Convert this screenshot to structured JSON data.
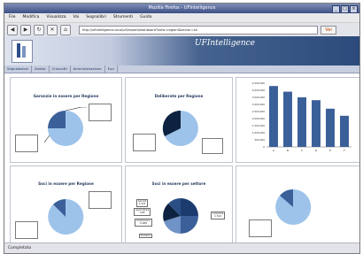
{
  "window": {
    "title": "Mozilla Firefox - UFIntelligence"
  },
  "menubar": {
    "items": [
      "File",
      "Modifica",
      "Visualizza",
      "Vai",
      "Segnalibri",
      "Strumenti",
      "Guida"
    ]
  },
  "toolbar": {
    "url": "http://ufintelligence.local/ufi/report/dashboard?view=regioni&sector=all",
    "go_label": "Vai"
  },
  "banner": {
    "brand": "UFIntelligence"
  },
  "nav": {
    "tabs": [
      "Segnalazioni",
      "Analisi",
      "Cruscotti",
      "Amministrazione",
      "Esci"
    ]
  },
  "panels": [
    {
      "title": "Garanzie in essere per Regione"
    },
    {
      "title": "Deliberate per Regione"
    },
    {
      "title": ""
    },
    {
      "title": "Soci in essere per Regione"
    },
    {
      "title": "Soci in essere per settore"
    },
    {
      "title": ""
    }
  ],
  "pie_labels": [
    {
      "name": "Servizi",
      "value": "1.321"
    },
    {
      "name": "Agricoltura",
      "value": "128"
    },
    {
      "name": "Commercio",
      "value": "2.089"
    },
    {
      "name": "Industria",
      "value": "1.512"
    },
    {
      "name": "Turismo",
      "value": ""
    }
  ],
  "chart_data": {
    "type": "bar",
    "categories": [
      "A",
      "B",
      "C",
      "D",
      "E",
      "F"
    ],
    "values": [
      4300000,
      3900000,
      3500000,
      3300000,
      2700000,
      2200000
    ],
    "ylim": [
      0,
      4500000
    ],
    "yticks": [
      "4.500.000",
      "4.000.000",
      "3.500.000",
      "3.000.000",
      "2.500.000",
      "2.000.000",
      "1.500.000",
      "1.000.000",
      "500.000",
      "0"
    ],
    "color": "#3a5f99"
  },
  "status": {
    "text": "Completato"
  }
}
